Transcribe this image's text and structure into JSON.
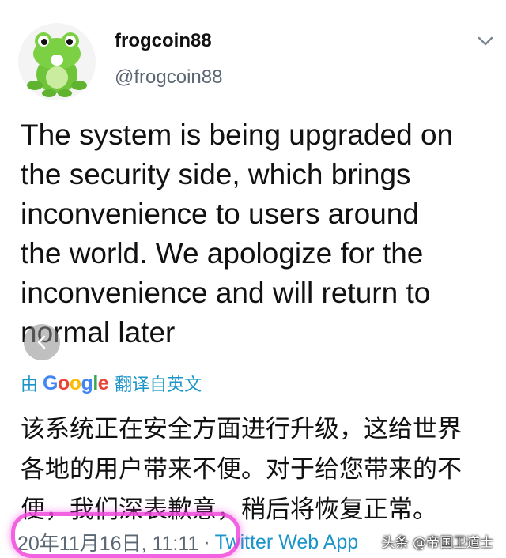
{
  "user": {
    "display_name": "frogcoin88",
    "handle": "@frogcoin88",
    "avatar_icon": "frog-avatar-icon"
  },
  "tweet": {
    "text_lines": [
      "The system is being upgraded on",
      "the security side, which brings",
      "inconvenience to users around",
      "the world. We apologize for the",
      "inconvenience and will return to",
      "normal later"
    ]
  },
  "translation": {
    "by_label": "由",
    "provider": "Google",
    "from_label": "翻译自英文",
    "lines": [
      "该系统正在安全方面进行升级，这给世界",
      "各地的用户带来不便。对于给您带来的不",
      "便，我们深表歉意，稍后将恢复正常。"
    ]
  },
  "meta": {
    "date": "20年11月16日, 11:11",
    "separator": "·",
    "source": "Twitter Web App"
  },
  "watermark": "头条 @帝国卫道士",
  "colors": {
    "link": "#1b95c9",
    "muted": "#5b6773",
    "highlight": "#f046dc"
  }
}
